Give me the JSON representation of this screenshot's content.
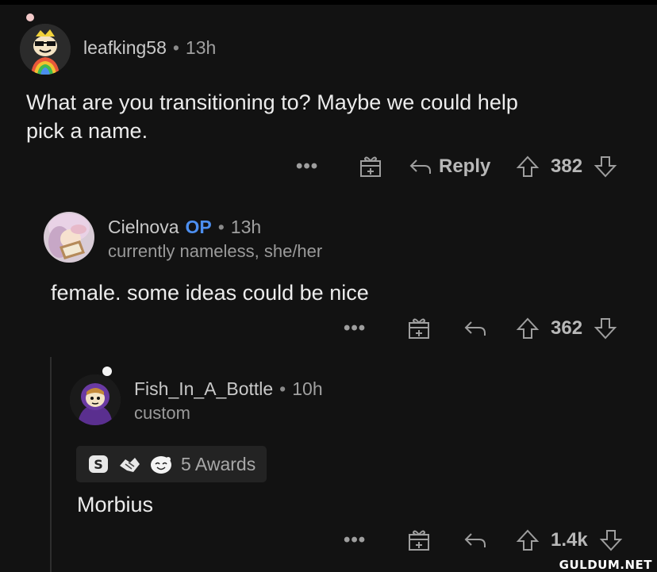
{
  "comments": [
    {
      "username": "leafking58",
      "time": "13h",
      "body_line1": "What are you transitioning to? Maybe we could help",
      "body_line2": "pick a name.",
      "reply_label": "Reply",
      "votes": "382"
    },
    {
      "username": "Cielnova",
      "op_badge": "OP",
      "time": "13h",
      "flair": "currently nameless, she/her",
      "body": "female. some ideas could be nice",
      "votes": "362"
    },
    {
      "username": "Fish_In_A_Bottle",
      "time": "10h",
      "flair": "custom",
      "awards_label": "5 Awards",
      "body": "Morbius",
      "votes": "1.4k"
    }
  ],
  "separator": "•",
  "more_glyph": "•••",
  "watermark": "GULDUM.NET",
  "colors": {
    "background": "#121212",
    "op_blue": "#4d8ff0",
    "muted": "#9e9e9e"
  }
}
